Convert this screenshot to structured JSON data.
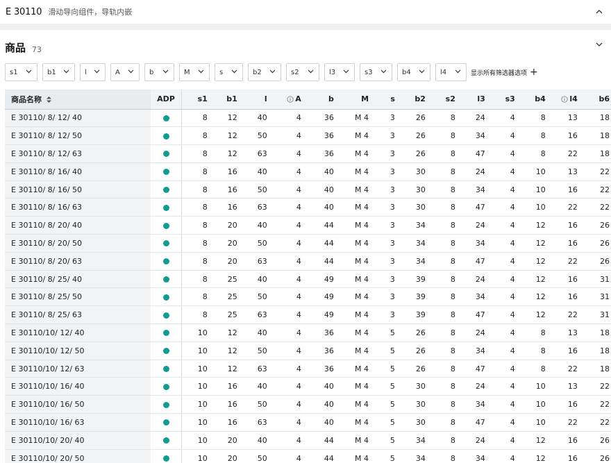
{
  "header": {
    "code": "E 30110",
    "description": "滑动导向组件，导轨内嵌",
    "collapse_icon": "chevron-up-icon"
  },
  "products": {
    "title": "商品",
    "count": "73",
    "expand_icon": "chevron-down-icon"
  },
  "filters": [
    {
      "label": "s1",
      "width": 47
    },
    {
      "label": "b1",
      "width": 47
    },
    {
      "label": "l",
      "width": 37
    },
    {
      "label": "A",
      "width": 42
    },
    {
      "label": "b",
      "width": 43
    },
    {
      "label": "M",
      "width": 44
    },
    {
      "label": "s",
      "width": 41
    },
    {
      "label": "b2",
      "width": 48
    },
    {
      "label": "s2",
      "width": 48
    },
    {
      "label": "l3",
      "width": 44
    },
    {
      "label": "s3",
      "width": 47
    },
    {
      "label": "b4",
      "width": 48
    },
    {
      "label": "l4",
      "width": 45
    }
  ],
  "show_all_filters": "显示所有筛选器选项",
  "table": {
    "columns": [
      {
        "key": "name",
        "label": "商品名称",
        "sortable": true,
        "width": 205
      },
      {
        "key": "adp",
        "label": "ADP",
        "width": 44
      },
      {
        "key": "s1",
        "label": "s1",
        "width": 42
      },
      {
        "key": "b1",
        "label": "b1",
        "width": 42
      },
      {
        "key": "l",
        "label": "l",
        "width": 42
      },
      {
        "key": "A",
        "label": "A",
        "info": true,
        "width": 48
      },
      {
        "key": "b",
        "label": "b",
        "width": 46
      },
      {
        "key": "M",
        "label": "M",
        "width": 49
      },
      {
        "key": "s",
        "label": "s",
        "width": 37
      },
      {
        "key": "b2",
        "label": "b2",
        "width": 43
      },
      {
        "key": "s2",
        "label": "s2",
        "width": 42
      },
      {
        "key": "l3",
        "label": "l3",
        "width": 42
      },
      {
        "key": "s3",
        "label": "s3",
        "width": 42
      },
      {
        "key": "b4",
        "label": "b4",
        "width": 43
      },
      {
        "key": "l4",
        "label": "l4",
        "info": true,
        "width": 45
      },
      {
        "key": "b6",
        "label": "b6",
        "width": 45
      }
    ],
    "status_color": "#139b92",
    "rows": [
      [
        "E 30110/ 8/ 12/ 40",
        "8",
        "12",
        "40",
        "4",
        "36",
        "M 4",
        "3",
        "26",
        "8",
        "24",
        "4",
        "8",
        "13",
        "18"
      ],
      [
        "E 30110/ 8/ 12/ 50",
        "8",
        "12",
        "50",
        "4",
        "36",
        "M 4",
        "3",
        "26",
        "8",
        "34",
        "4",
        "8",
        "16",
        "18"
      ],
      [
        "E 30110/ 8/ 12/ 63",
        "8",
        "12",
        "63",
        "4",
        "36",
        "M 4",
        "3",
        "26",
        "8",
        "47",
        "4",
        "8",
        "22",
        "18"
      ],
      [
        "E 30110/ 8/ 16/ 40",
        "8",
        "16",
        "40",
        "4",
        "40",
        "M 4",
        "3",
        "30",
        "8",
        "24",
        "4",
        "10",
        "13",
        "22"
      ],
      [
        "E 30110/ 8/ 16/ 50",
        "8",
        "16",
        "50",
        "4",
        "40",
        "M 4",
        "3",
        "30",
        "8",
        "34",
        "4",
        "10",
        "16",
        "22"
      ],
      [
        "E 30110/ 8/ 16/ 63",
        "8",
        "16",
        "63",
        "4",
        "40",
        "M 4",
        "3",
        "30",
        "8",
        "47",
        "4",
        "10",
        "22",
        "22"
      ],
      [
        "E 30110/ 8/ 20/ 40",
        "8",
        "20",
        "40",
        "4",
        "44",
        "M 4",
        "3",
        "34",
        "8",
        "24",
        "4",
        "12",
        "16",
        "26"
      ],
      [
        "E 30110/ 8/ 20/ 50",
        "8",
        "20",
        "50",
        "4",
        "44",
        "M 4",
        "3",
        "34",
        "8",
        "34",
        "4",
        "12",
        "16",
        "26"
      ],
      [
        "E 30110/ 8/ 20/ 63",
        "8",
        "20",
        "63",
        "4",
        "44",
        "M 4",
        "3",
        "34",
        "8",
        "47",
        "4",
        "12",
        "22",
        "26"
      ],
      [
        "E 30110/ 8/ 25/ 40",
        "8",
        "25",
        "40",
        "4",
        "49",
        "M 4",
        "3",
        "39",
        "8",
        "24",
        "4",
        "12",
        "16",
        "31"
      ],
      [
        "E 30110/ 8/ 25/ 50",
        "8",
        "25",
        "50",
        "4",
        "49",
        "M 4",
        "3",
        "39",
        "8",
        "34",
        "4",
        "12",
        "16",
        "31"
      ],
      [
        "E 30110/ 8/ 25/ 63",
        "8",
        "25",
        "63",
        "4",
        "49",
        "M 4",
        "3",
        "39",
        "8",
        "47",
        "4",
        "12",
        "22",
        "31"
      ],
      [
        "E 30110/10/ 12/ 40",
        "10",
        "12",
        "40",
        "4",
        "36",
        "M 4",
        "5",
        "26",
        "8",
        "24",
        "4",
        "8",
        "13",
        "18"
      ],
      [
        "E 30110/10/ 12/ 50",
        "10",
        "12",
        "50",
        "4",
        "36",
        "M 4",
        "5",
        "26",
        "8",
        "34",
        "4",
        "8",
        "16",
        "18"
      ],
      [
        "E 30110/10/ 12/ 63",
        "10",
        "12",
        "63",
        "4",
        "36",
        "M 4",
        "5",
        "26",
        "8",
        "47",
        "4",
        "8",
        "22",
        "18"
      ],
      [
        "E 30110/10/ 16/ 40",
        "10",
        "16",
        "40",
        "4",
        "40",
        "M 4",
        "5",
        "30",
        "8",
        "24",
        "4",
        "10",
        "13",
        "22"
      ],
      [
        "E 30110/10/ 16/ 50",
        "10",
        "16",
        "50",
        "4",
        "40",
        "M 4",
        "5",
        "30",
        "8",
        "34",
        "4",
        "10",
        "16",
        "22"
      ],
      [
        "E 30110/10/ 16/ 63",
        "10",
        "16",
        "63",
        "4",
        "40",
        "M 4",
        "5",
        "30",
        "8",
        "47",
        "4",
        "10",
        "22",
        "22"
      ],
      [
        "E 30110/10/ 20/ 40",
        "10",
        "20",
        "40",
        "4",
        "44",
        "M 4",
        "5",
        "34",
        "8",
        "24",
        "4",
        "12",
        "16",
        "26"
      ],
      [
        "E 30110/10/ 20/ 50",
        "10",
        "20",
        "50",
        "4",
        "44",
        "M 4",
        "5",
        "34",
        "8",
        "34",
        "4",
        "12",
        "16",
        "26"
      ]
    ]
  }
}
